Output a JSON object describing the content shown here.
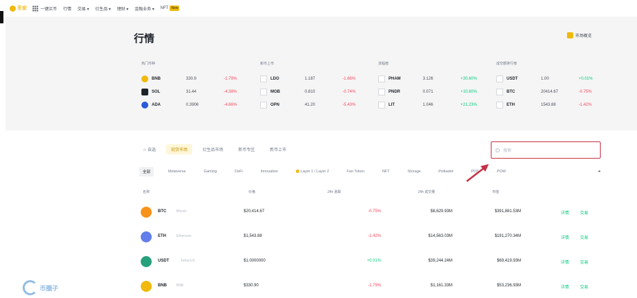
{
  "topnav": {
    "logo": "币安",
    "items": [
      "一键买币",
      "行情",
      "交易 ▾",
      "衍生品 ▾",
      "理财 ▾",
      "金融业务 ▾",
      "NFT"
    ],
    "nft_badge": "New"
  },
  "hero": {
    "title": "行情",
    "link": "市场概览",
    "panels": [
      {
        "title": "热门币种",
        "rows": [
          {
            "sym": "BNB",
            "price": "330.9",
            "chg": "-1.79%",
            "dir": "neg",
            "color": "#f0b90b"
          },
          {
            "sym": "SOL",
            "price": "31.44",
            "chg": "-4.38%",
            "dir": "neg",
            "color": "#1e2329"
          },
          {
            "sym": "ADA",
            "price": "0.3906",
            "chg": "-4.66%",
            "dir": "neg",
            "color": "#2a5ada"
          }
        ]
      },
      {
        "title": "新币上市",
        "rows": [
          {
            "sym": "LDO",
            "price": "1.187",
            "chg": "-1.66%",
            "dir": "neg"
          },
          {
            "sym": "MOB",
            "price": "0.810",
            "chg": "-0.74%",
            "dir": "neg"
          },
          {
            "sym": "OPN",
            "price": "41.20",
            "chg": "-5.43%",
            "dir": "neg"
          }
        ]
      },
      {
        "title": "涨幅榜",
        "rows": [
          {
            "sym": "PHAM",
            "price": "3.126",
            "chg": "+30.60%",
            "dir": "pos"
          },
          {
            "sym": "PNDR",
            "price": "0.071",
            "chg": "+10.60%",
            "dir": "pos"
          },
          {
            "sym": "LIT",
            "price": "1.046",
            "chg": "+21.23%",
            "dir": "pos"
          }
        ]
      },
      {
        "title": "成交额排行榜",
        "rows": [
          {
            "sym": "USDT",
            "price": "1.00",
            "chg": "+0.01%",
            "dir": "pos"
          },
          {
            "sym": "BTC",
            "price": "20414.67",
            "chg": "-0.75%",
            "dir": "neg"
          },
          {
            "sym": "ETH",
            "price": "1543.88",
            "chg": "-1.42%",
            "dir": "neg"
          }
        ]
      }
    ]
  },
  "tabs": [
    "自选",
    "现货市场",
    "衍生品市场",
    "新币专区",
    "新币上市"
  ],
  "search_placeholder": "搜索",
  "categories": [
    "全部",
    "Metaverse",
    "Gaming",
    "DeFi",
    "Innovation",
    "Layer 1 / Layer 2",
    "Fan Token",
    "NFT",
    "Storage",
    "Polkadot",
    "POS",
    "POW"
  ],
  "table": {
    "headers": {
      "name": "名称",
      "price": "价格",
      "change": "24h 涨跌",
      "volume": "24h 成交量",
      "cap": "市值"
    },
    "rows": [
      {
        "sym": "BTC",
        "name": "Bitcoin",
        "price": "$20,414.67",
        "chg": "-0.75%",
        "vol": "$8,629.93M",
        "cap": "$391,881.53M",
        "color": "#f7931a",
        "dir": "neg"
      },
      {
        "sym": "ETH",
        "name": "Ethereum",
        "price": "$1,543.88",
        "chg": "-1.42%",
        "vol": "$14,563.03M",
        "cap": "$191,270.34M",
        "color": "#627eea",
        "dir": "neg"
      },
      {
        "sym": "USDT",
        "name": "TetherUS",
        "price": "$1.0000000",
        "chg": "+0.01%",
        "vol": "$39,244.24M",
        "cap": "$69,419.93M",
        "color": "#26a17b",
        "dir": "pos"
      },
      {
        "sym": "BNB",
        "name": "BNB",
        "price": "$330.90",
        "chg": "-1.79%",
        "vol": "$1,161.33M",
        "cap": "$53,236.93M",
        "color": "#f0b90b",
        "dir": "neg"
      }
    ],
    "actions": [
      "详情",
      "交易"
    ]
  },
  "watermark": "币圈子"
}
